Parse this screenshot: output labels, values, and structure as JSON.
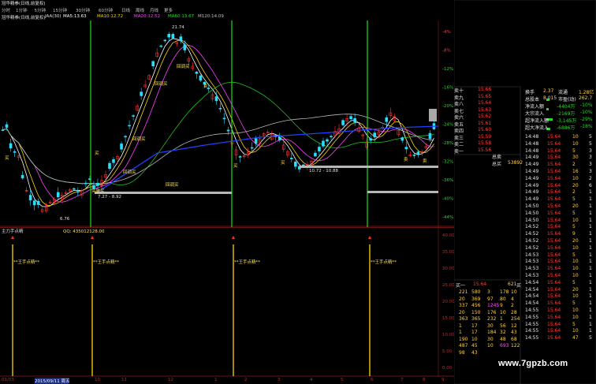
{
  "header": {
    "title": "冠华精拳(日线,前复权)",
    "code_field": "JAA(30)",
    "ma_fields": [
      {
        "label": "MA5:",
        "value": "13.63",
        "color": "#ffffff"
      },
      {
        "label": "MA10:",
        "value": "12.72",
        "color": "#ffd400"
      },
      {
        "label": "MA20:",
        "value": "12.52",
        "color": "#ff40ff"
      },
      {
        "label": "MA60:",
        "value": "13.67",
        "color": "#20e020"
      },
      {
        "label": "M120:",
        "value": "14.09",
        "color": "#c0c0c0"
      }
    ]
  },
  "period_tabs": [
    "分时",
    "1分钟",
    "5分钟",
    "15分钟",
    "30分钟",
    "60分钟",
    "日线",
    "周线",
    "月线",
    "更多"
  ],
  "main_chart": {
    "y_axis_labels": [
      "-4%",
      "-8%",
      "-12%",
      "-16%",
      "-20%",
      "-24%",
      "-28%",
      "-32%",
      "-36%",
      "-40%",
      "-44%"
    ],
    "price_annotations": {
      "high": "21.74",
      "low": "6.76",
      "mid_range": "10.72 - 10.88",
      "left_range": "7.27 - 8.92"
    },
    "signal_labels": [
      "买",
      "买",
      "买",
      "买",
      "突破买",
      "回调买",
      "回调买",
      "回调买",
      "回调买",
      "回调买",
      "卖",
      "卖",
      "卖"
    ]
  },
  "lower_chart": {
    "title": "主力手点精",
    "subtitle": "QQ: 435012128.00",
    "y_axis_labels": [
      "40.00",
      "35.00",
      "30.00",
      "25.00",
      "20.00",
      "15.00",
      "10.00",
      "5.00",
      "0.00"
    ],
    "signal_text": "**王手点精**"
  },
  "time_axis": [
    "01/03",
    "2015/09/11 周五",
    "10",
    "11",
    "12",
    "1",
    "2",
    "3",
    "4",
    "5",
    "6",
    "7",
    "8",
    "9"
  ],
  "order_book": {
    "sell_levels": [
      {
        "name": "卖十",
        "price": "15.66"
      },
      {
        "name": "卖九",
        "price": "15.65"
      },
      {
        "name": "卖八",
        "price": "15.64"
      },
      {
        "name": "卖七",
        "price": "15.63"
      },
      {
        "name": "卖六",
        "price": "15.62"
      },
      {
        "name": "卖五",
        "price": "15.61"
      },
      {
        "name": "卖四",
        "price": "15.60"
      },
      {
        "name": "卖三",
        "price": "15.59"
      },
      {
        "name": "卖二",
        "price": "15.58"
      },
      {
        "name": "卖一",
        "price": "15.56"
      }
    ],
    "total_sell_label": "总卖",
    "total_buy_label": "总买",
    "total_buy_value": "53892",
    "buy_one_label": "买一",
    "buy_one_price": "15.64",
    "buy_one_volume": "621",
    "buy_one_flag": "买",
    "buy_queue": [
      [
        "221",
        "580",
        "3",
        "178",
        "10"
      ],
      [
        "20",
        "369",
        "97",
        "80",
        "4"
      ],
      [
        "337",
        "456",
        "1245",
        "9",
        "2"
      ],
      [
        "20",
        "150",
        "176",
        "10",
        "28"
      ],
      [
        "363",
        "365",
        "232",
        "1",
        "254"
      ],
      [
        "1",
        "17",
        "30",
        "56",
        "12"
      ],
      [
        "1",
        "17",
        "184",
        "32",
        "43"
      ],
      [
        "190",
        "10",
        "30",
        "48",
        "68"
      ],
      [
        "487",
        "45",
        "10",
        "693",
        "122"
      ],
      [
        "98",
        "43",
        "",
        "",
        ""
      ]
    ]
  },
  "flow_summary": {
    "rows": [
      {
        "label": "换手",
        "value": "2.37",
        "label2": "流通",
        "value2": "1.28亿"
      },
      {
        "label": "总股本",
        "value": "8.015",
        "label2": "市盈(动)",
        "value2": "262.7"
      },
      {
        "label": "净流入额",
        "value": "-4404万",
        "pct": "-10%"
      },
      {
        "label": "大宗流入",
        "value": "-2169万",
        "pct": "-10%"
      },
      {
        "label": "超净流入额",
        "value": "-3,145万",
        "pct": "-29%"
      },
      {
        "label": "超大净流入",
        "value": "-6886万",
        "pct": "-18%"
      }
    ]
  },
  "ticks": [
    {
      "time": "14:48",
      "price": "15.64",
      "vol": "10",
      "count": "5"
    },
    {
      "time": "14:48",
      "price": "15.64",
      "vol": "10",
      "count": "5"
    },
    {
      "time": "14:48",
      "price": "15.64",
      "vol": "5",
      "count": "3"
    },
    {
      "time": "14:49",
      "price": "15.64",
      "vol": "30",
      "count": "3"
    },
    {
      "time": "14:49",
      "price": "15.64",
      "vol": "2",
      "count": "3"
    },
    {
      "time": "14:49",
      "price": "15.64",
      "vol": "16",
      "count": "3"
    },
    {
      "time": "14:49",
      "price": "15.64",
      "vol": "10",
      "count": "2"
    },
    {
      "time": "14:49",
      "price": "15.64",
      "vol": "20",
      "count": "6"
    },
    {
      "time": "14:49",
      "price": "15.64",
      "vol": "2",
      "count": "1"
    },
    {
      "time": "14:49",
      "price": "15.64",
      "vol": "5",
      "count": "1"
    },
    {
      "time": "14:50",
      "price": "15.64",
      "vol": "20",
      "count": "1"
    },
    {
      "time": "14:50",
      "price": "15.64",
      "vol": "5",
      "count": "1"
    },
    {
      "time": "14:50",
      "price": "15.64",
      "vol": "10",
      "count": "1"
    },
    {
      "time": "14:52",
      "price": "15.64",
      "vol": "5",
      "count": "1"
    },
    {
      "time": "14:52",
      "price": "15.64",
      "vol": "9",
      "count": "1"
    },
    {
      "time": "14:52",
      "price": "15.64",
      "vol": "20",
      "count": "1"
    },
    {
      "time": "14:52",
      "price": "15.64",
      "vol": "10",
      "count": "1"
    },
    {
      "time": "14:53",
      "price": "15.64",
      "vol": "5",
      "count": "1"
    },
    {
      "time": "14:53",
      "price": "15.64",
      "vol": "10",
      "count": "1"
    },
    {
      "time": "14:53",
      "price": "15.64",
      "vol": "10",
      "count": "1"
    },
    {
      "time": "14:53",
      "price": "15.64",
      "vol": "10",
      "count": "1"
    },
    {
      "time": "14:54",
      "price": "15.64",
      "vol": "5",
      "count": "1"
    },
    {
      "time": "14:54",
      "price": "15.64",
      "vol": "20",
      "count": "1"
    },
    {
      "time": "14:54",
      "price": "15.64",
      "vol": "10",
      "count": "1"
    },
    {
      "time": "14:54",
      "price": "15.64",
      "vol": "5",
      "count": "1"
    },
    {
      "time": "14:55",
      "price": "15.64",
      "vol": "10",
      "count": "1"
    },
    {
      "time": "14:55",
      "price": "15.64",
      "vol": "10",
      "count": "1"
    },
    {
      "time": "14:55",
      "price": "15.64",
      "vol": "5",
      "count": "1"
    },
    {
      "time": "14:55",
      "price": "15.64",
      "vol": "10",
      "count": "1"
    },
    {
      "time": "14:55",
      "price": "15.64",
      "vol": "47",
      "count": "5"
    }
  ],
  "watermark": "www.7gpzb.com"
}
